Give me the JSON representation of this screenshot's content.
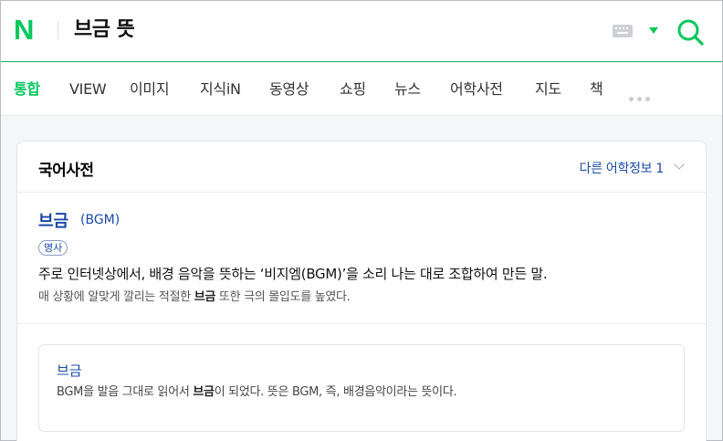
{
  "header": {
    "logo": "N",
    "query": "브금 뜻"
  },
  "tabs": [
    {
      "label": "통합",
      "active": true
    },
    {
      "label": "VIEW"
    },
    {
      "label": "이미지"
    },
    {
      "label": "지식iN"
    },
    {
      "label": "동영상"
    },
    {
      "label": "쇼핑"
    },
    {
      "label": "뉴스"
    },
    {
      "label": "어학사전"
    },
    {
      "label": "지도"
    },
    {
      "label": "책"
    }
  ],
  "dictionary": {
    "title": "국어사전",
    "more_label": "다른 어학정보 1",
    "entry": {
      "word": "브금",
      "origin": "(BGM)",
      "pos": "명사",
      "definition": "주로 인터넷상에서, 배경 음악을 뜻하는 ‘비지엠(BGM)’을 소리 나는 대로 조합하여 만든 말.",
      "example_pre": "매 상황에 알맞게 깔리는 적절한 ",
      "example_bold": "브금",
      "example_post": " 또한 극의 몰입도를 높였다."
    },
    "related": {
      "word": "브금",
      "text_pre": "BGM을 발음 그대로 읽어서 ",
      "text_bold": "브금",
      "text_post": "이 되었다. 뜻은 BGM, 즉, 배경음악이라는 뜻이다."
    }
  },
  "colors": {
    "brand": "#03c75a",
    "link": "#1a49a5"
  }
}
